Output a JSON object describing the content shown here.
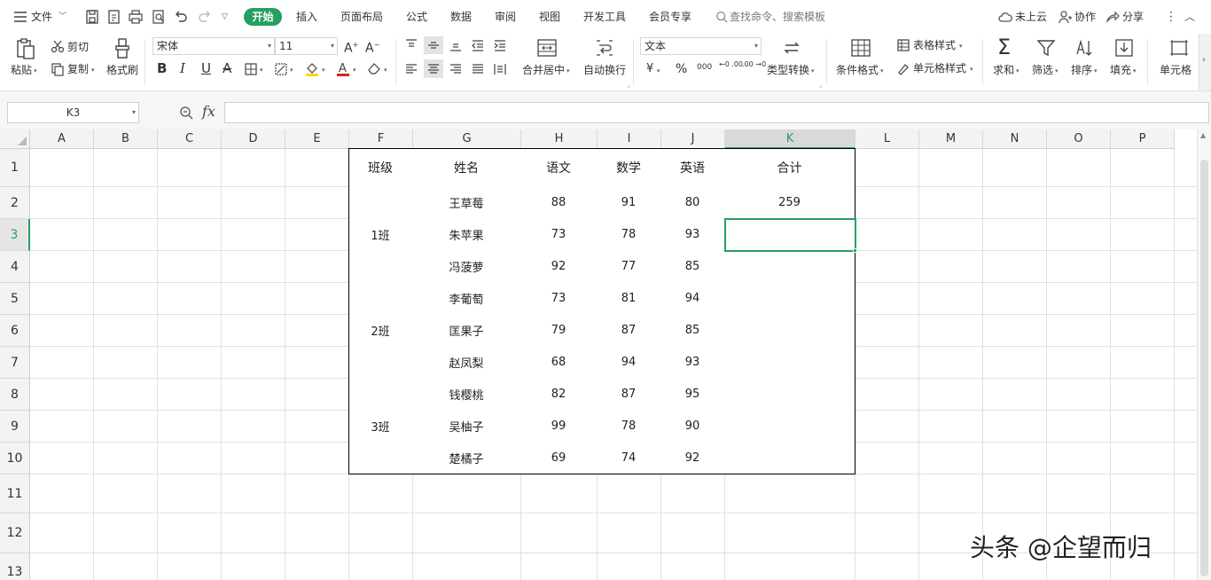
{
  "tabbar": {
    "file_menu": "文件",
    "tabs": [
      "开始",
      "插入",
      "页面布局",
      "公式",
      "数据",
      "审阅",
      "视图",
      "开发工具",
      "会员专享"
    ],
    "search_placeholder": "查找命令、搜索模板",
    "cloud_status": "未上云",
    "collab": "协作",
    "share": "分享"
  },
  "ribbon": {
    "paste": "粘贴",
    "cut": "剪切",
    "copy": "复制",
    "format_painter": "格式刷",
    "font_name": "宋体",
    "font_size": "11",
    "merge_center": "合并居中",
    "auto_wrap": "自动换行",
    "number_format": "文本",
    "type_convert": "类型转换",
    "cond_format": "条件格式",
    "table_style": "表格样式",
    "cell_style": "单元格样式",
    "sum": "求和",
    "filter": "筛选",
    "sort": "排序",
    "fill": "填充",
    "cell": "单元格",
    "currency": "¥",
    "percent": "%",
    "thousands": "000",
    "dec_inc": "←0 .00",
    "dec_dec": ".00 →0"
  },
  "formula_bar": {
    "name_box": "K3",
    "fx": "fx",
    "value": ""
  },
  "columns": [
    "A",
    "B",
    "C",
    "D",
    "E",
    "F",
    "G",
    "H",
    "I",
    "J",
    "K",
    "L",
    "M",
    "N",
    "O",
    "P"
  ],
  "rows": [
    "1",
    "2",
    "3",
    "4",
    "5",
    "6",
    "7",
    "8",
    "9",
    "10",
    "11",
    "12",
    "13"
  ],
  "selected_cell": "K3",
  "table": {
    "headers": [
      "班级",
      "姓名",
      "语文",
      "数学",
      "英语",
      "合计"
    ],
    "classes": [
      "1班",
      "2班",
      "3班"
    ],
    "records": [
      {
        "name": "王草莓",
        "chinese": "88",
        "math": "91",
        "english": "80",
        "total": "259"
      },
      {
        "name": "朱苹果",
        "chinese": "73",
        "math": "78",
        "english": "93",
        "total": ""
      },
      {
        "name": "冯菠萝",
        "chinese": "92",
        "math": "77",
        "english": "85",
        "total": ""
      },
      {
        "name": "李葡萄",
        "chinese": "73",
        "math": "81",
        "english": "94",
        "total": ""
      },
      {
        "name": "匡果子",
        "chinese": "79",
        "math": "87",
        "english": "85",
        "total": ""
      },
      {
        "name": "赵凤梨",
        "chinese": "68",
        "math": "94",
        "english": "93",
        "total": ""
      },
      {
        "name": "钱樱桃",
        "chinese": "82",
        "math": "87",
        "english": "95",
        "total": ""
      },
      {
        "name": "吴柚子",
        "chinese": "99",
        "math": "78",
        "english": "90",
        "total": ""
      },
      {
        "name": "楚橘子",
        "chinese": "69",
        "math": "74",
        "english": "92",
        "total": ""
      }
    ]
  },
  "watermark": "头条 @企望而归",
  "colors": {
    "accent": "#25a05f"
  }
}
